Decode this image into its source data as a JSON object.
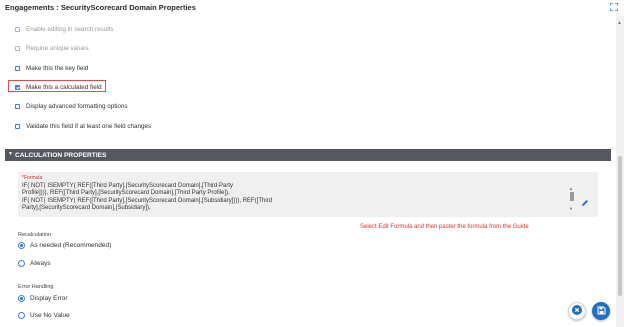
{
  "header": {
    "title": "Engagements : SecurityScorecard Domain Properties"
  },
  "options": [
    {
      "label": "Enable editing in search results",
      "checked": false,
      "disabled": true
    },
    {
      "label": "Require unique values",
      "checked": false,
      "disabled": true
    },
    {
      "label": "Make this the key field",
      "checked": false,
      "disabled": false
    },
    {
      "label": "Make this a calculated field",
      "checked": true,
      "disabled": false
    },
    {
      "label": "Display advanced formatting options",
      "checked": false,
      "disabled": false
    },
    {
      "label": "Validate this field if at least one field changes",
      "checked": false,
      "disabled": false
    }
  ],
  "section": {
    "title": "CALCULATION PROPERTIES"
  },
  "formula": {
    "label": "*Formula",
    "text": "IF( NOT( ISEMPTY( REF([Third Party],[SecurityScorecard Domain],[Third Party\nProfile]))), REF([Third Party],[SecurityScorecard Domain],[Third Party Profile]),\nIF( NOT( ISEMPTY( REF([Third Party],[SecurityScorecard Domain],[Subsidiary]))), REF([Third\nParty],[SecurityScorecard Domain],[Subsidiary]),"
  },
  "guide_note": "Select Edit Formula and then paster the formula from the Guide",
  "recalculation": {
    "label": "Recalculation",
    "options": [
      {
        "label": "As needed (Recommended)",
        "selected": true
      },
      {
        "label": "Always",
        "selected": false
      }
    ]
  },
  "error_handling": {
    "label": "Error Handling",
    "options": [
      {
        "label": "Display Error",
        "selected": true
      },
      {
        "label": "Use No Value",
        "selected": false
      }
    ]
  },
  "icons": {
    "expand": "expand-icon",
    "edit": "pencil-icon",
    "cancel": "cancel-icon",
    "save": "save-icon"
  },
  "colors": {
    "accent": "#1f6fc5",
    "highlight_border": "#e04c4c",
    "section_bar": "#55595f",
    "note": "#d9362c"
  }
}
